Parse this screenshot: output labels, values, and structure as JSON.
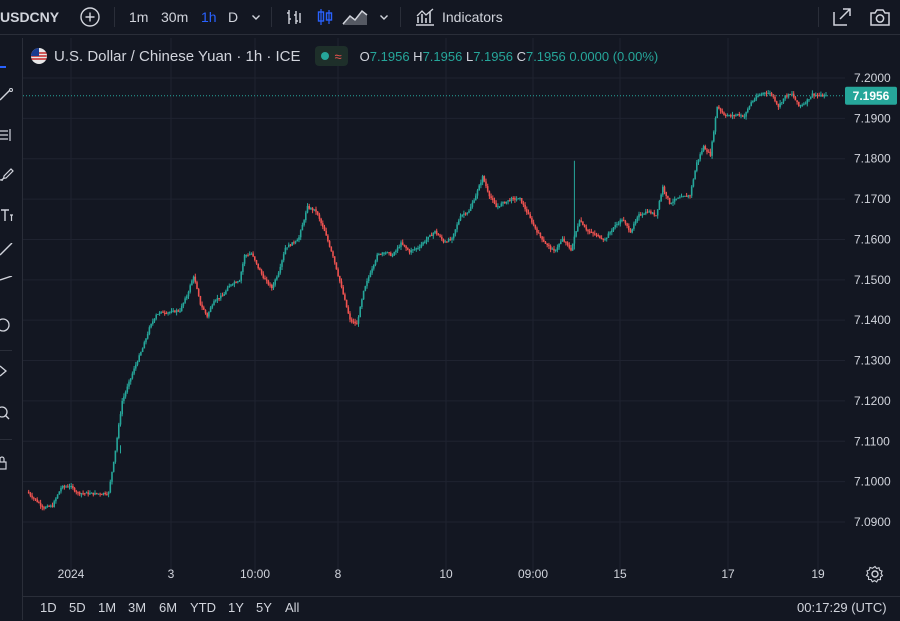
{
  "toolbar": {
    "symbol": "USDCNY",
    "intervals": [
      "1m",
      "30m",
      "1h",
      "D"
    ],
    "active_interval": "1h",
    "indicators_label": "Indicators"
  },
  "legend": {
    "title": "U.S. Dollar / Chinese Yuan · 1h · ICE",
    "o_label": "O",
    "o": "7.1956",
    "h_label": "H",
    "h": "7.1956",
    "l_label": "L",
    "l": "7.1956",
    "c_label": "C",
    "c": "7.1956",
    "change": "0.0000 (0.00%)"
  },
  "price_axis": {
    "labels": [
      "7.2000",
      "7.1900",
      "7.1800",
      "7.1700",
      "7.1600",
      "7.1500",
      "7.1400",
      "7.1300",
      "7.1200",
      "7.1100",
      "7.1000",
      "7.0900"
    ],
    "current_price": "7.1956"
  },
  "time_axis": {
    "labels": [
      "2024",
      "3",
      "10:00",
      "8",
      "10",
      "09:00",
      "15",
      "17",
      "19"
    ]
  },
  "range_buttons": [
    "1D",
    "5D",
    "1M",
    "3M",
    "6M",
    "YTD",
    "1Y",
    "5Y",
    "All"
  ],
  "clock": "00:17:29 (UTC)",
  "colors": {
    "background": "#131722",
    "up": "#26a69a",
    "down": "#ef5350",
    "grid": "#1f2330",
    "accent": "#2962ff"
  },
  "chart_data": {
    "type": "candlestick",
    "symbol": "USDCNY",
    "interval": "1h",
    "ylim": [
      7.088,
      7.2025
    ],
    "x_tick_labels": [
      "2024",
      "3",
      "10:00",
      "8",
      "10",
      "09:00",
      "15",
      "17",
      "19"
    ],
    "y_tick_labels": [
      "7.2000",
      "7.1900",
      "7.1800",
      "7.1700",
      "7.1600",
      "7.1500",
      "7.1400",
      "7.1300",
      "7.1200",
      "7.1100",
      "7.1000",
      "7.0900"
    ],
    "last_price": 7.1956,
    "close_path": [
      [
        0,
        7.0975
      ],
      [
        5,
        7.0955
      ],
      [
        10,
        7.0935
      ],
      [
        15,
        7.094
      ],
      [
        20,
        7.0985
      ],
      [
        25,
        7.099
      ],
      [
        30,
        7.0972
      ],
      [
        40,
        7.097
      ],
      [
        48,
        7.0972
      ],
      [
        52,
        7.1078
      ],
      [
        56,
        7.12
      ],
      [
        60,
        7.1245
      ],
      [
        64,
        7.129
      ],
      [
        68,
        7.133
      ],
      [
        72,
        7.138
      ],
      [
        76,
        7.1415
      ],
      [
        80,
        7.142
      ],
      [
        85,
        7.142
      ],
      [
        90,
        7.1425
      ],
      [
        94,
        7.146
      ],
      [
        98,
        7.151
      ],
      [
        102,
        7.144
      ],
      [
        106,
        7.141
      ],
      [
        110,
        7.145
      ],
      [
        115,
        7.146
      ],
      [
        120,
        7.149
      ],
      [
        125,
        7.15
      ],
      [
        128,
        7.156
      ],
      [
        132,
        7.1565
      ],
      [
        136,
        7.153
      ],
      [
        140,
        7.15
      ],
      [
        144,
        7.148
      ],
      [
        148,
        7.152
      ],
      [
        152,
        7.158
      ],
      [
        156,
        7.159
      ],
      [
        160,
        7.1605
      ],
      [
        165,
        7.168
      ],
      [
        170,
        7.167
      ],
      [
        175,
        7.162
      ],
      [
        180,
        7.156
      ],
      [
        185,
        7.148
      ],
      [
        190,
        7.14
      ],
      [
        194,
        7.139
      ],
      [
        198,
        7.147
      ],
      [
        202,
        7.152
      ],
      [
        206,
        7.156
      ],
      [
        210,
        7.157
      ],
      [
        215,
        7.156
      ],
      [
        220,
        7.159
      ],
      [
        225,
        7.157
      ],
      [
        230,
        7.158
      ],
      [
        235,
        7.16
      ],
      [
        240,
        7.162
      ],
      [
        245,
        7.1595
      ],
      [
        250,
        7.16
      ],
      [
        255,
        7.166
      ],
      [
        260,
        7.167
      ],
      [
        265,
        7.172
      ],
      [
        268,
        7.1755
      ],
      [
        272,
        7.171
      ],
      [
        276,
        7.168
      ],
      [
        280,
        7.169
      ],
      [
        285,
        7.17
      ],
      [
        290,
        7.17
      ],
      [
        295,
        7.166
      ],
      [
        300,
        7.162
      ],
      [
        305,
        7.159
      ],
      [
        310,
        7.157
      ],
      [
        315,
        7.16
      ],
      [
        320,
        7.1575
      ],
      [
        325,
        7.165
      ],
      [
        330,
        7.162
      ],
      [
        335,
        7.161
      ],
      [
        340,
        7.16
      ],
      [
        345,
        7.163
      ],
      [
        350,
        7.165
      ],
      [
        355,
        7.162
      ],
      [
        360,
        7.166
      ],
      [
        365,
        7.167
      ],
      [
        370,
        7.166
      ],
      [
        374,
        7.173
      ],
      [
        378,
        7.169
      ],
      [
        382,
        7.17
      ],
      [
        386,
        7.1705
      ],
      [
        390,
        7.171
      ],
      [
        394,
        7.179
      ],
      [
        398,
        7.183
      ],
      [
        402,
        7.181
      ],
      [
        406,
        7.193
      ],
      [
        410,
        7.191
      ],
      [
        414,
        7.1905
      ],
      [
        418,
        7.191
      ],
      [
        422,
        7.1905
      ],
      [
        426,
        7.194
      ],
      [
        430,
        7.1955
      ],
      [
        434,
        7.1965
      ],
      [
        438,
        7.196
      ],
      [
        442,
        7.193
      ],
      [
        446,
        7.1955
      ],
      [
        450,
        7.196
      ],
      [
        454,
        7.193
      ],
      [
        458,
        7.194
      ],
      [
        462,
        7.196
      ],
      [
        466,
        7.1956
      ],
      [
        470,
        7.1956
      ]
    ]
  }
}
